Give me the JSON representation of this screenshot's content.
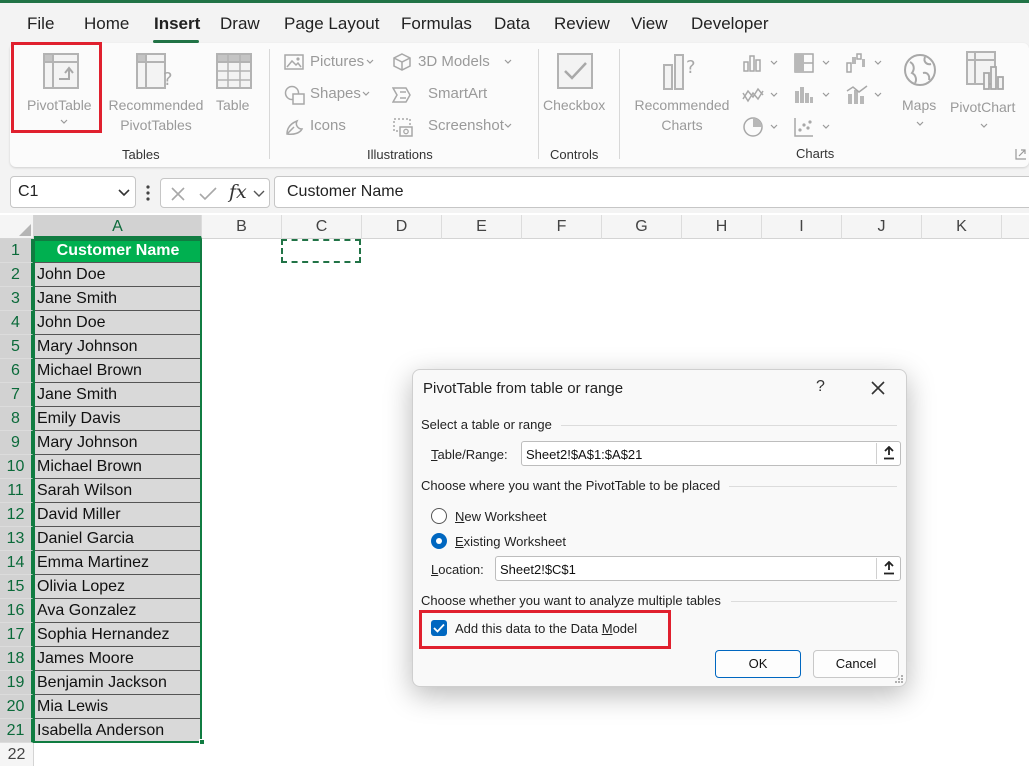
{
  "menu": {
    "items": [
      "File",
      "Home",
      "Insert",
      "Draw",
      "Page Layout",
      "Formulas",
      "Data",
      "Review",
      "View",
      "Developer"
    ],
    "active": "Insert"
  },
  "ribbon": {
    "tables": {
      "group_label": "Tables",
      "pivottable": "PivotTable",
      "recommended_1": "Recommended",
      "recommended_2": "PivotTables",
      "table": "Table"
    },
    "illustrations": {
      "group_label": "Illustrations",
      "pictures": "Pictures",
      "shapes": "Shapes",
      "icons": "Icons",
      "models_3d": "3D Models",
      "smartart": "SmartArt",
      "screenshot": "Screenshot"
    },
    "controls": {
      "group_label": "Controls",
      "checkbox": "Checkbox"
    },
    "charts": {
      "group_label": "Charts",
      "recommended_1": "Recommended",
      "recommended_2": "Charts",
      "maps": "Maps",
      "pivotchart": "PivotChart"
    }
  },
  "formula_bar": {
    "name_box": "C1",
    "fx": "fx",
    "content": "Customer Name"
  },
  "grid": {
    "columns": [
      "A",
      "B",
      "C",
      "D",
      "E",
      "F",
      "G",
      "H",
      "I",
      "J",
      "K"
    ],
    "rows": [
      "1",
      "2",
      "3",
      "4",
      "5",
      "6",
      "7",
      "8",
      "9",
      "10",
      "11",
      "12",
      "13",
      "14",
      "15",
      "16",
      "17",
      "18",
      "19",
      "20",
      "21",
      "22"
    ],
    "column_a": [
      "Customer Name",
      "John Doe",
      "Jane Smith",
      "John Doe",
      "Mary Johnson",
      "Michael Brown",
      "Jane Smith",
      "Emily Davis",
      "Mary Johnson",
      "Michael Brown",
      "Sarah Wilson",
      "David Miller",
      "Daniel Garcia",
      "Emma Martinez",
      "Olivia Lopez",
      "Ava Gonzalez",
      "Sophia Hernandez",
      "James Moore",
      "Benjamin Jackson",
      "Mia Lewis",
      "Isabella Anderson"
    ]
  },
  "dialog": {
    "title": "PivotTable from table or range",
    "help": "?",
    "section_select": "Select a table or range",
    "table_range_label_u": "T",
    "table_range_label_rest": "able/Range:",
    "table_range_value": "Sheet2!$A$1:$A$21",
    "section_place": "Choose where you want the PivotTable to be placed",
    "new_ws_u": "N",
    "new_ws_rest": "ew Worksheet",
    "existing_ws_u": "E",
    "existing_ws_rest": "xisting Worksheet",
    "location_label_u": "L",
    "location_label_rest": "ocation:",
    "location_value": "Sheet2!$C$1",
    "section_multi": "Choose whether you want to analyze multiple tables",
    "data_model_pre": "Add this data to the Data ",
    "data_model_u": "M",
    "data_model_post": "odel",
    "ok": "OK",
    "cancel": "Cancel"
  },
  "colors": {
    "excel_green": "#217346",
    "header_fill": "#00b050",
    "data_fill": "#d9d9d9",
    "highlight_red": "#e0202e",
    "accent_blue": "#0067c0"
  }
}
